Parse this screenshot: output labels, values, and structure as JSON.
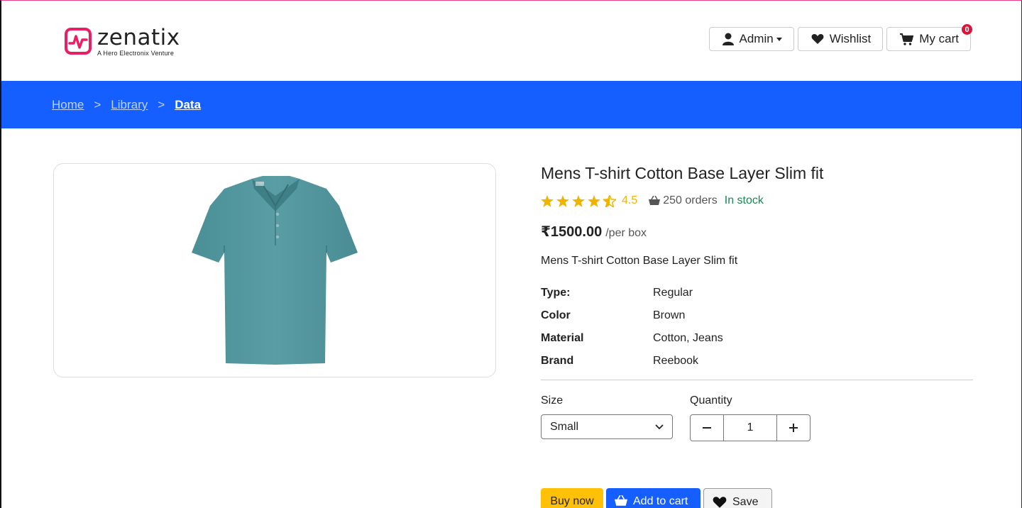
{
  "brand": {
    "name": "zenatix",
    "tagline": "A Hero Electronix Venture",
    "accent": "#e91e63"
  },
  "nav": {
    "admin_label": "Admin",
    "wishlist_label": "Wishlist",
    "cart_label": "My cart",
    "cart_count": "0"
  },
  "breadcrumb": {
    "items": [
      "Home",
      "Library",
      "Data"
    ],
    "separator": ">"
  },
  "product": {
    "title": "Mens T-shirt Cotton Base Layer Slim fit",
    "rating": "4.5",
    "rating_fill": 4.5,
    "orders": "250 orders",
    "stock": "In stock",
    "price": "₹1500.00",
    "unit": "/per box",
    "description": "Mens T-shirt Cotton Base Layer Slim fit",
    "specs": [
      {
        "key": "Type:",
        "value": "Regular"
      },
      {
        "key": "Color",
        "value": "Brown"
      },
      {
        "key": "Material",
        "value": "Cotton, Jeans"
      },
      {
        "key": "Brand",
        "value": "Reebook"
      }
    ]
  },
  "options": {
    "size_label": "Size",
    "size_value": "Small",
    "quantity_label": "Quantity",
    "quantity_value": "1"
  },
  "actions": {
    "buy_label": "Buy now",
    "add_to_cart_label": "Add to cart",
    "save_label": "Save"
  },
  "colors": {
    "primary": "#155eff",
    "star": "#f0b400",
    "stock": "#198754",
    "badge": "#dc143c",
    "buy": "#ffc107"
  }
}
